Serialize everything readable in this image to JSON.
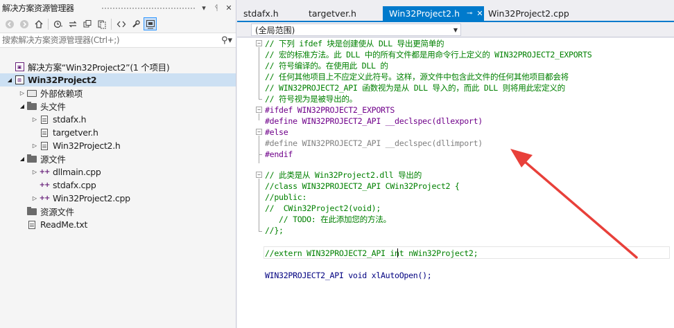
{
  "solution_explorer": {
    "title": "解决方案资源管理器",
    "window_buttons": {
      "dropdown": "▾",
      "pin": "ᛩ",
      "close": "✕"
    },
    "search_placeholder": "搜索解决方案资源管理器(Ctrl+;)",
    "tree": [
      {
        "label": "解决方案“Win32Project2”(1 个项目)",
        "icon": "solution-icon",
        "level": 0,
        "expander": ""
      },
      {
        "label": "Win32Project2",
        "icon": "project-icon",
        "level": 0,
        "expander": "◢",
        "bold": true,
        "selected": true
      },
      {
        "label": "外部依赖项",
        "icon": "references-icon",
        "level": 1,
        "expander": "▷"
      },
      {
        "label": "头文件",
        "icon": "folder-icon",
        "level": 1,
        "expander": "◢"
      },
      {
        "label": "stdafx.h",
        "icon": "header-file-icon",
        "level": 2,
        "expander": "▷"
      },
      {
        "label": "targetver.h",
        "icon": "header-file-icon",
        "level": 2,
        "expander": ""
      },
      {
        "label": "Win32Project2.h",
        "icon": "header-file-icon",
        "level": 2,
        "expander": "▷"
      },
      {
        "label": "源文件",
        "icon": "folder-icon",
        "level": 1,
        "expander": "◢"
      },
      {
        "label": "dllmain.cpp",
        "icon": "cpp-file-icon",
        "level": 2,
        "expander": "▷"
      },
      {
        "label": "stdafx.cpp",
        "icon": "cpp-file-icon",
        "level": 2,
        "expander": ""
      },
      {
        "label": "Win32Project2.cpp",
        "icon": "cpp-file-icon",
        "level": 2,
        "expander": "▷"
      },
      {
        "label": "资源文件",
        "icon": "folder-icon",
        "level": 1,
        "expander": ""
      },
      {
        "label": "ReadMe.txt",
        "icon": "text-file-icon",
        "level": 1,
        "expander": ""
      }
    ]
  },
  "editor": {
    "tabs": [
      {
        "label": "stdafx.h",
        "active": false
      },
      {
        "label": "targetver.h",
        "active": false
      },
      {
        "label": "Win32Project2.h",
        "active": true
      },
      {
        "label": "Win32Project2.cpp",
        "active": false
      }
    ],
    "scope": "(全局范围)",
    "lines": [
      {
        "text": "// 下列 ifdef 块是创建使从 DLL 导出更简单的",
        "style": "comment"
      },
      {
        "text": "// 宏的标准方法。此 DLL 中的所有文件都是用命令行上定义的 WIN32PROJECT2_EXPORTS",
        "style": "comment"
      },
      {
        "text": "// 符号编译的。在使用此 DLL 的",
        "style": "comment"
      },
      {
        "text": "// 任何其他项目上不应定义此符号。这样，源文件中包含此文件的任何其他项目都会将",
        "style": "comment"
      },
      {
        "text": "// WIN32PROJECT2_API 函数视为是从 DLL 导入的，而此 DLL 则将用此宏定义的",
        "style": "comment"
      },
      {
        "text": "// 符号视为是被导出的。",
        "style": "comment"
      },
      {
        "text": "#ifdef WIN32PROJECT2_EXPORTS",
        "style": "pre"
      },
      {
        "text": "#define WIN32PROJECT2_API __declspec(dllexport)",
        "style": "pre"
      },
      {
        "text": "#else",
        "style": "pre"
      },
      {
        "text": "#define WIN32PROJECT2_API __declspec(dllimport)",
        "style": "dim"
      },
      {
        "text": "#endif",
        "style": "pre"
      },
      {
        "text": "",
        "style": "plain"
      },
      {
        "text": "// 此类是从 Win32Project2.dll 导出的",
        "style": "comment"
      },
      {
        "text": "//class WIN32PROJECT2_API CWin32Project2 {",
        "style": "comment"
      },
      {
        "text": "//public:",
        "style": "comment"
      },
      {
        "text": "//  CWin32Project2(void);",
        "style": "comment"
      },
      {
        "text": "   // TODO: 在此添加您的方法。",
        "style": "comment"
      },
      {
        "text": "//};",
        "style": "comment"
      },
      {
        "text": "",
        "style": "plain"
      },
      {
        "text": "//extern WIN32PROJECT2_API int nWin32Project2;",
        "style": "comment"
      },
      {
        "text": "",
        "style": "plain"
      },
      {
        "text": "WIN32PROJECT2_API void xlAutoOpen();",
        "style": "plain"
      }
    ]
  },
  "colors": {
    "accent": "#007acc",
    "comment": "#008000",
    "preprocessor": "#6f008a",
    "inactive": "#808080",
    "annotation_arrow": "#e8403a"
  }
}
